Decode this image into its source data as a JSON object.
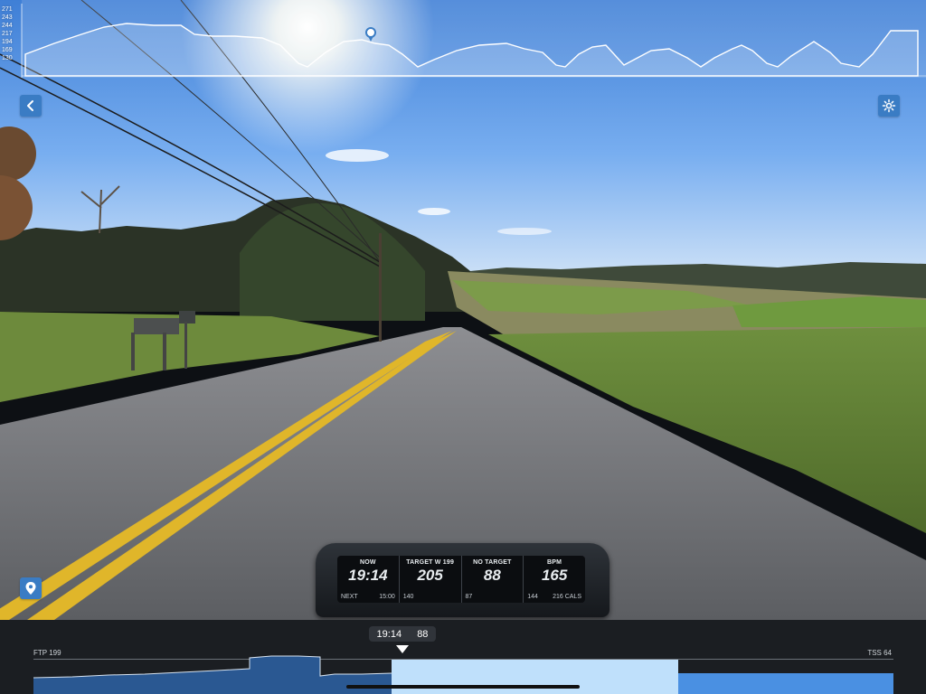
{
  "elevation_profile": {
    "axis_labels": [
      "271",
      "243",
      "244",
      "217",
      "194",
      "169",
      "130"
    ]
  },
  "hud": {
    "now_label": "NOW",
    "elapsed": "19:14",
    "next_label": "NEXT",
    "next_time": "15:00",
    "target_label": "TARGET W 199",
    "power": "205",
    "power_sub": "140",
    "cadence_label": "NO TARGET",
    "cadence": "88",
    "cadence_sub": "87",
    "hr_label": "BPM",
    "heart_rate": "165",
    "hr_sub": "144",
    "calories": "216 CALS"
  },
  "workout_bar": {
    "time": "19:14",
    "cadence": "88",
    "ftp_label": "FTP 199",
    "tss_label": "TSS 64"
  },
  "icons": {
    "back": "chevron-left-icon",
    "settings": "gear-icon",
    "map": "map-pin-icon"
  },
  "colors": {
    "accent": "#3a7cc4",
    "completed_segment": "#2a5892",
    "current_segment": "#bfe0fb",
    "upcoming_segment": "#4a90e2"
  }
}
